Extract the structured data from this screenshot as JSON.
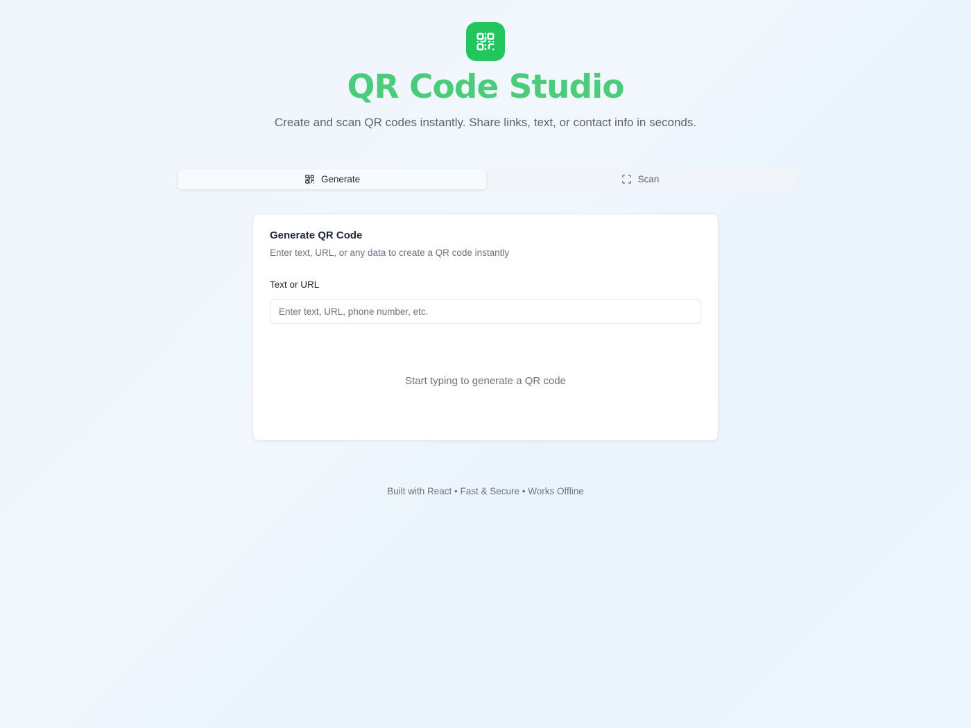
{
  "header": {
    "logo_icon": "qr-code-icon",
    "title": "QR Code Studio",
    "subtitle": "Create and scan QR codes instantly. Share links, text, or contact info in seconds."
  },
  "tabs": [
    {
      "label": "Generate",
      "icon": "qr-code-icon",
      "active": true
    },
    {
      "label": "Scan",
      "icon": "scan-frame-icon",
      "active": false
    }
  ],
  "card": {
    "title": "Generate QR Code",
    "description": "Enter text, URL, or any data to create a QR code instantly",
    "field_label": "Text or URL",
    "input_value": "",
    "input_placeholder": "Enter text, URL, phone number, etc.",
    "empty_message": "Start typing to generate a QR code"
  },
  "footer": {
    "text": "Built with React • Fast & Secure • Works Offline"
  },
  "colors": {
    "accent": "#22c55e",
    "title": "#4ccb7a",
    "background": "#eef6fc"
  }
}
